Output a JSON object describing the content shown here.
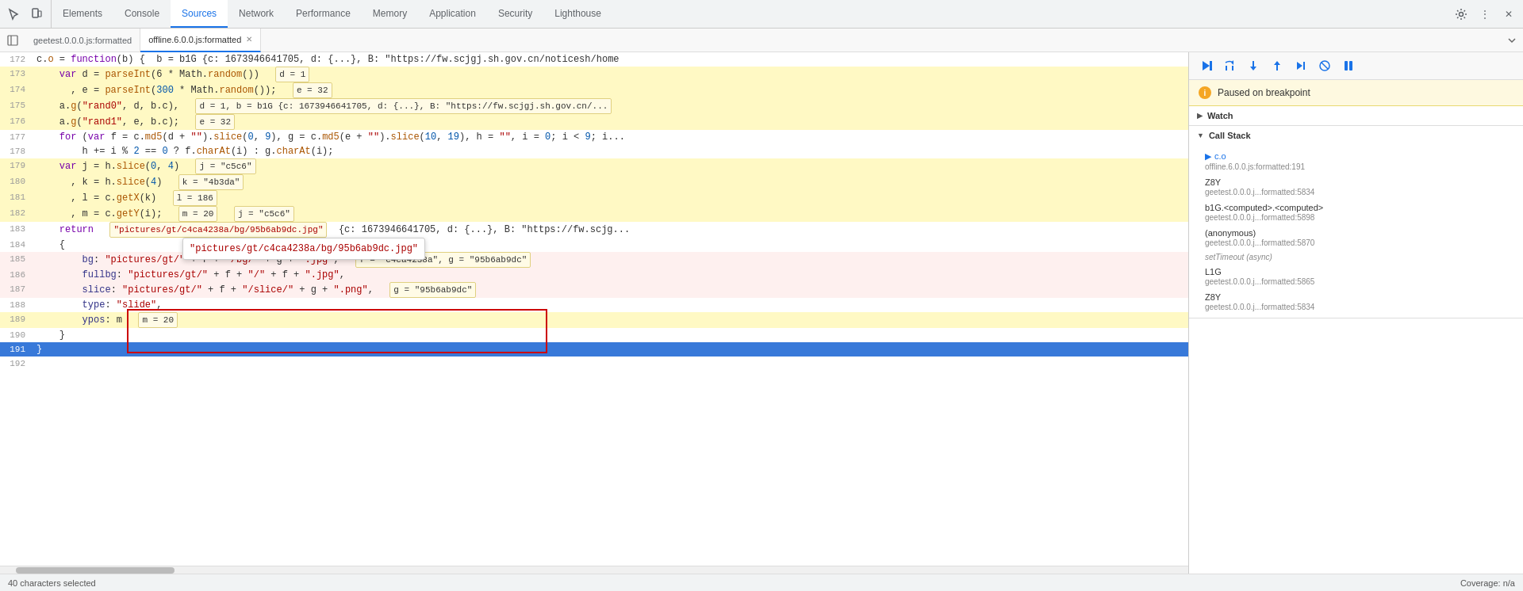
{
  "nav": {
    "tabs": [
      {
        "label": "Elements",
        "active": false
      },
      {
        "label": "Console",
        "active": false
      },
      {
        "label": "Sources",
        "active": true
      },
      {
        "label": "Network",
        "active": false
      },
      {
        "label": "Performance",
        "active": false
      },
      {
        "label": "Memory",
        "active": false
      },
      {
        "label": "Application",
        "active": false
      },
      {
        "label": "Security",
        "active": false
      },
      {
        "label": "Lighthouse",
        "active": false
      }
    ]
  },
  "file_tabs": [
    {
      "label": "geetest.0.0.0.js:formatted",
      "active": false,
      "closeable": false
    },
    {
      "label": "offline.6.0.0.js:formatted",
      "active": true,
      "closeable": true
    }
  ],
  "code": {
    "lines": [
      {
        "num": 172,
        "content": "c.o = function(b) {  b = b1G {c: 1673946641705, d: {...}, B: \"https://fw.scjgj.sh.gov.cn/noticesh/home...",
        "highlight": false,
        "breakpoint": false,
        "active": false
      },
      {
        "num": 173,
        "content": "    var d = parseInt(6 * Math.random())  d = 1",
        "highlight": true,
        "breakpoint": false,
        "active": false
      },
      {
        "num": 174,
        "content": "      , e = parseInt(300 * Math.random());  e = 32",
        "highlight": true,
        "breakpoint": false,
        "active": false
      },
      {
        "num": 175,
        "content": "    a.g(\"rand0\", d, b.c),  d = 1, b = b1G {c: 1673946641705, d: {...}, B: \"https://fw.scjgj.sh.gov.cn/...",
        "highlight": true,
        "breakpoint": false,
        "active": false
      },
      {
        "num": 176,
        "content": "    a.g(\"rand1\", e, b.c);  e = 32",
        "highlight": true,
        "breakpoint": false,
        "active": false
      },
      {
        "num": 177,
        "content": "    for (var f = c.md5(d + \"\").slice(0, 9), g = c.md5(e + \"\").slice(10, 19), h = \"\", i = 0; i < 9; i...",
        "highlight": false,
        "breakpoint": false,
        "active": false
      },
      {
        "num": 178,
        "content": "        h += i % 2 == 0 ? f.charAt(i) : g.charAt(i);",
        "highlight": false,
        "breakpoint": false,
        "active": false
      },
      {
        "num": 179,
        "content": "    var j = h.slice(0, 4)  j = \"c5c6\"",
        "highlight": true,
        "breakpoint": false,
        "active": false
      },
      {
        "num": 180,
        "content": "      , k = h.slice(4)  k = \"4b3da\"",
        "highlight": true,
        "breakpoint": false,
        "active": false
      },
      {
        "num": 181,
        "content": "      , l = c.getX(k)  l = 186",
        "highlight": true,
        "breakpoint": false,
        "active": false
      },
      {
        "num": 182,
        "content": "      , m = c.getY(i);  m = 20  j = \"c5c6\"",
        "highlight": true,
        "breakpoint": false,
        "active": false
      },
      {
        "num": 183,
        "content": "    return  \"pictures/gt/c4ca4238a/bg/95b6ab9dc.jpg\"  {c: 1673946641705, d: {...}, B: \"https://fw.scjg...",
        "highlight": false,
        "breakpoint": false,
        "active": false
      },
      {
        "num": 184,
        "content": "    {",
        "highlight": false,
        "breakpoint": false,
        "active": false
      },
      {
        "num": 185,
        "content": "        bg: \"pictures/gt/\" + f + \"/bg/\" + g + \".jpg\",  f = \"c4ca4238a\", g = \"95b6ab9dc\"",
        "highlight": false,
        "breakpoint": true,
        "active": false
      },
      {
        "num": 186,
        "content": "        fullbg: \"pictures/gt/\" + f + \"/\" + f + \".jpg\",",
        "highlight": false,
        "breakpoint": true,
        "active": false
      },
      {
        "num": 187,
        "content": "        slice: \"pictures/gt/\" + f + \"/slice/\" + g + \".png\",  g = \"95b6ab9dc\"",
        "highlight": false,
        "breakpoint": true,
        "active": false
      },
      {
        "num": 188,
        "content": "        type: \"slide\",",
        "highlight": false,
        "breakpoint": false,
        "active": false
      },
      {
        "num": 189,
        "content": "        ypos: m  m = 20",
        "highlight": true,
        "breakpoint": false,
        "active": false
      },
      {
        "num": 190,
        "content": "    }",
        "highlight": false,
        "breakpoint": false,
        "active": false
      },
      {
        "num": 191,
        "content": "}",
        "highlight": false,
        "breakpoint": false,
        "active": true
      }
    ]
  },
  "tooltip": {
    "value": "\"pictures/gt/c4ca4238a/bg/95b6ab9dc.jpg\""
  },
  "right_panel": {
    "paused_message": "Paused on breakpoint",
    "sections": [
      {
        "label": "Watch",
        "collapsed": true,
        "items": []
      },
      {
        "label": "Call Stack",
        "collapsed": false,
        "items": [
          {
            "fn": "c.o",
            "loc": "offline.6.0.0.js:formatted:191",
            "active": true
          },
          {
            "fn": "Z8Y",
            "loc": "geetest.0.0.0.j...formatted:5834",
            "active": false
          },
          {
            "fn": "b1G.<computed>.<computed>",
            "loc": "geetest.0.0.0.j...formatted:5898",
            "active": false
          },
          {
            "fn": "(anonymous)",
            "loc": "geetest.0.0.0.j...formatted:5870",
            "active": false
          },
          {
            "async_label": "setTimeout (async)"
          },
          {
            "fn": "L1G",
            "loc": "geetest.0.0.0.j...formatted:5865",
            "active": false
          },
          {
            "fn": "Z8Y",
            "loc": "geetest.0.0.0.j...formatted:5834",
            "active": false
          }
        ]
      }
    ]
  },
  "status_bar": {
    "left": "40 characters selected",
    "right": "Coverage: n/a"
  }
}
